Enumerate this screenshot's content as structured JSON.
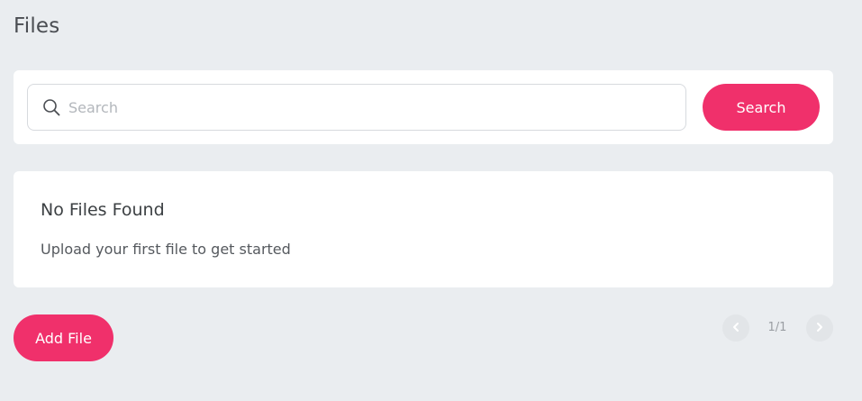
{
  "page": {
    "title": "Files"
  },
  "search": {
    "placeholder": "Search",
    "value": "",
    "button_label": "Search",
    "icon": "search-icon"
  },
  "empty_state": {
    "title": "No Files Found",
    "message": "Upload your first file to get started"
  },
  "actions": {
    "add_file_label": "Add File"
  },
  "pagination": {
    "display": "1/1",
    "current_page": 1,
    "total_pages": 1,
    "prev_icon": "chevron-left-icon",
    "next_icon": "chevron-right-icon"
  },
  "colors": {
    "accent": "#f0306b",
    "background": "#eaedf0",
    "card": "#ffffff"
  }
}
